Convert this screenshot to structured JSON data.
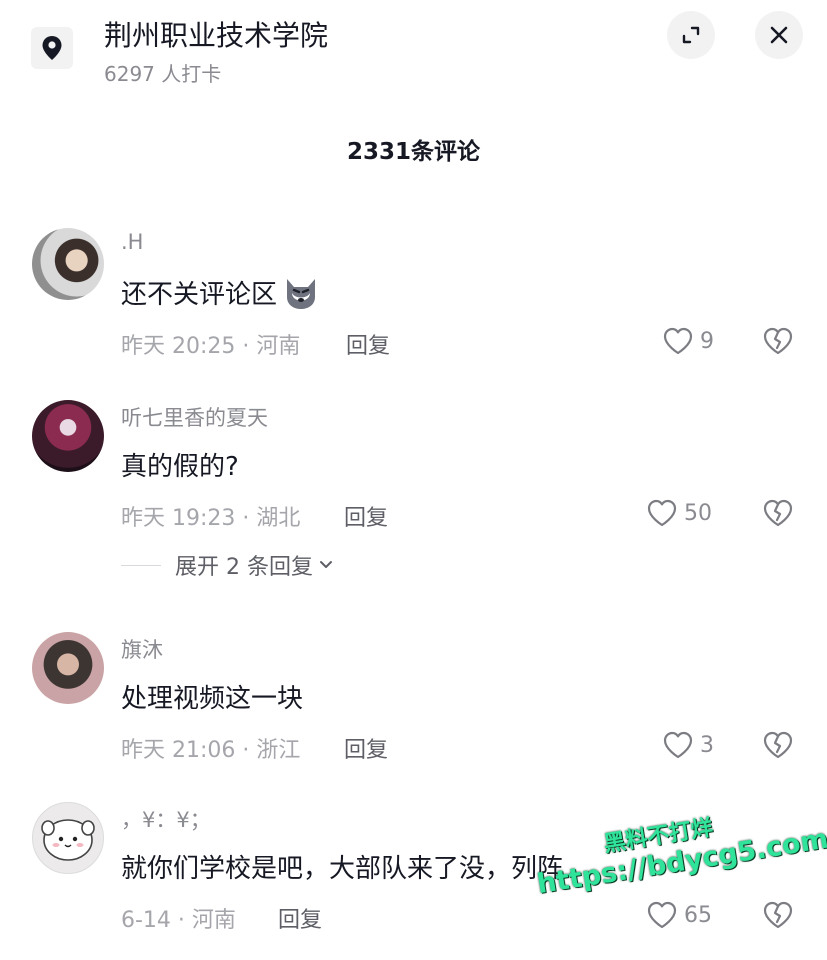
{
  "header": {
    "place_name": "荆州职业技术学院",
    "checkin_count": "6297 人打卡"
  },
  "comment_count": "2331条评论",
  "comments": [
    {
      "username": ".H",
      "text": "还不关评论区",
      "emoji": "wolf-emoji",
      "time_location": "昨天 20:25 · 河南",
      "reply_label": "回复",
      "likes": "9"
    },
    {
      "username": "听七里香的夏天",
      "text": "真的假的?",
      "time_location": "昨天 19:23 · 湖北",
      "reply_label": "回复",
      "likes": "50"
    },
    {
      "username": "旗沐",
      "text": "处理视频这一块",
      "time_location": "昨天 21:06 · 浙江",
      "reply_label": "回复",
      "likes": "3"
    },
    {
      "username": "，¥：¥；",
      "text": "就你们学校是吧，大部队来了没，列阵",
      "time_location": "6-14 · 河南",
      "reply_label": "回复",
      "likes": "65"
    }
  ],
  "expand_replies": "展开 2 条回复",
  "watermark": {
    "line1": "黑料不打烊",
    "line2": "https://bdycg5.com"
  },
  "colors": {
    "text_primary": "#161823",
    "text_secondary": "#8a8b91",
    "button_bg": "#f2f2f3",
    "watermark": "#2fe39a"
  }
}
